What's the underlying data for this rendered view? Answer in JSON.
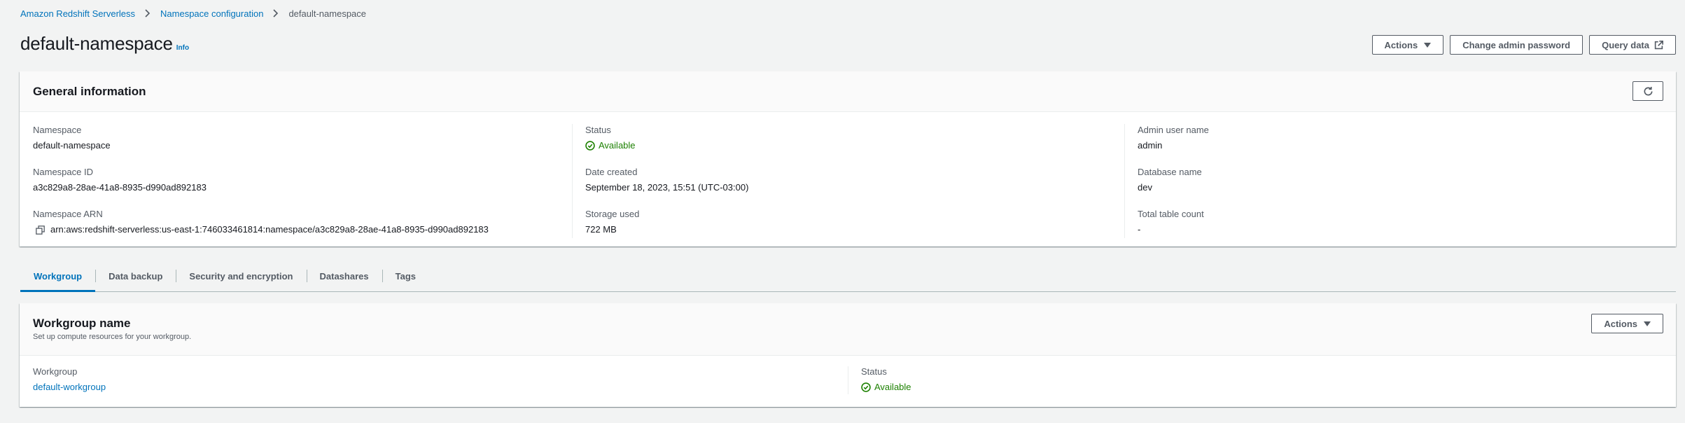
{
  "breadcrumb": {
    "items": [
      "Amazon Redshift Serverless",
      "Namespace configuration"
    ],
    "current": "default-namespace"
  },
  "header": {
    "title": "default-namespace",
    "info_label": "Info",
    "actions_label": "Actions",
    "change_password_label": "Change admin password",
    "query_data_label": "Query data"
  },
  "general": {
    "title": "General information",
    "namespace_label": "Namespace",
    "namespace_value": "default-namespace",
    "namespace_id_label": "Namespace ID",
    "namespace_id_value": "a3c829a8-28ae-41a8-8935-d990ad892183",
    "namespace_arn_label": "Namespace ARN",
    "namespace_arn_value": "arn:aws:redshift-serverless:us-east-1:746033461814:namespace/a3c829a8-28ae-41a8-8935-d990ad892183",
    "status_label": "Status",
    "status_value": "Available",
    "date_created_label": "Date created",
    "date_created_value": "September 18, 2023, 15:51 (UTC-03:00)",
    "storage_label": "Storage used",
    "storage_value": "722 MB",
    "admin_label": "Admin user name",
    "admin_value": "admin",
    "db_label": "Database name",
    "db_value": "dev",
    "table_count_label": "Total table count",
    "table_count_value": "-"
  },
  "tabs": [
    {
      "label": "Workgroup",
      "active": true
    },
    {
      "label": "Data backup"
    },
    {
      "label": "Security and encryption"
    },
    {
      "label": "Datashares"
    },
    {
      "label": "Tags"
    }
  ],
  "workgroup": {
    "title": "Workgroup name",
    "description": "Set up compute resources for your workgroup.",
    "actions_label": "Actions",
    "workgroup_label": "Workgroup",
    "workgroup_value": "default-workgroup",
    "status_label": "Status",
    "status_value": "Available"
  },
  "colors": {
    "link": "#0073bb",
    "success": "#1d8102",
    "background": "#f2f3f3"
  },
  "icons": [
    "chevron-right-icon",
    "caret-down-icon",
    "external-link-icon",
    "refresh-icon",
    "check-circle-icon",
    "copy-icon"
  ]
}
